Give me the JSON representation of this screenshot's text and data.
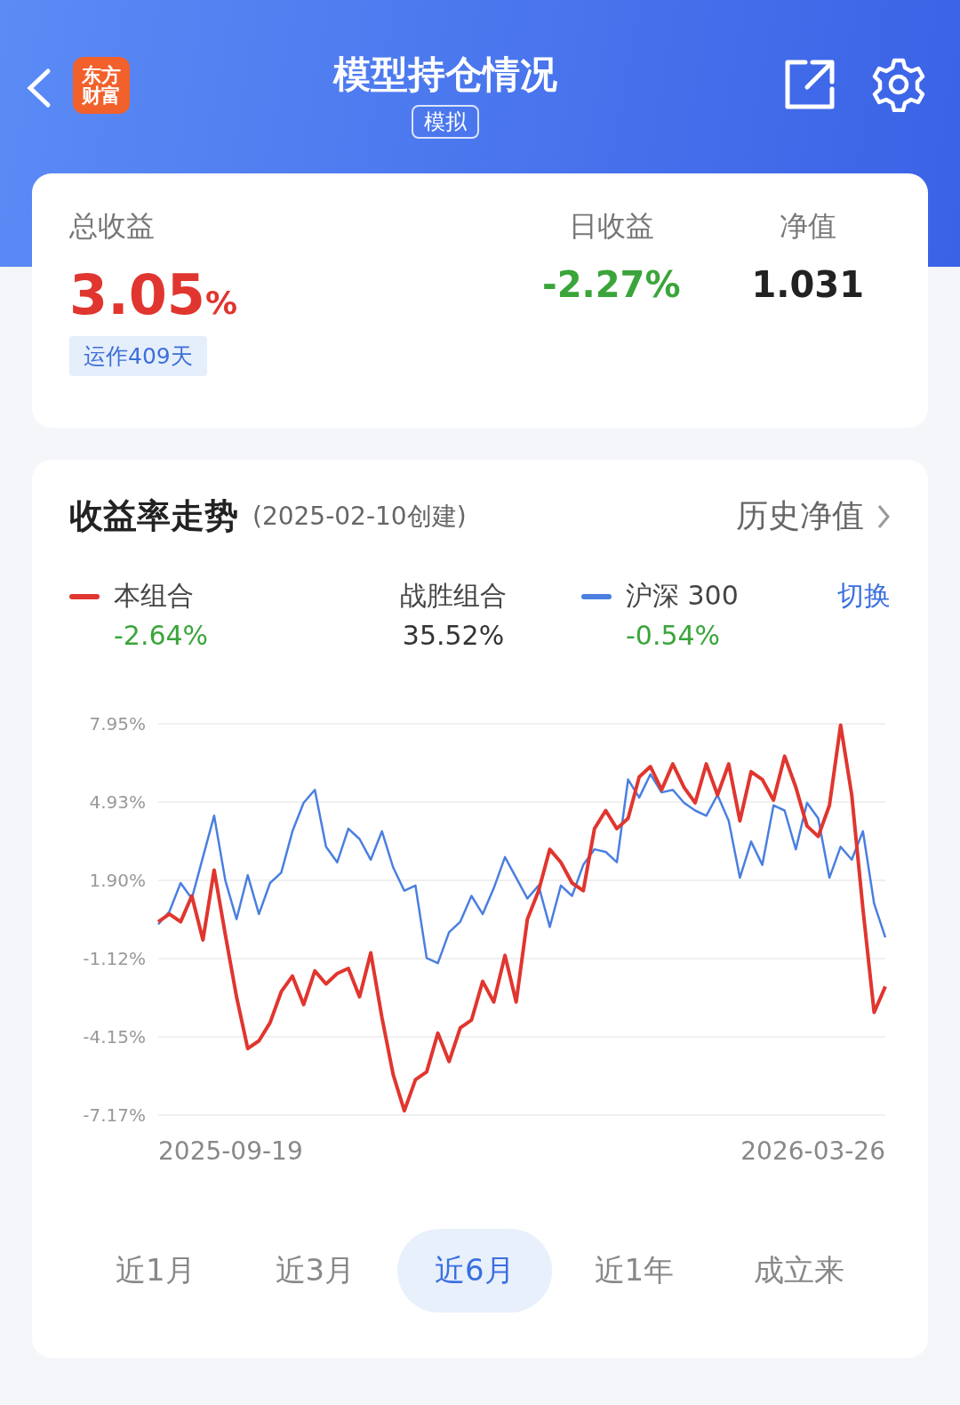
{
  "header": {
    "logo_lines": [
      "东方",
      "财富"
    ],
    "title": "模型持仓情况",
    "tag": "模拟"
  },
  "summary": {
    "total": {
      "label": "总收益",
      "value": "3.05",
      "unit": "%"
    },
    "days_badge": "运作409天",
    "daily": {
      "label": "日收益",
      "value": "-2.27%"
    },
    "nav": {
      "label": "净值",
      "value": "1.031"
    }
  },
  "trend": {
    "title": "收益率走势",
    "created": "(2025-02-10创建)",
    "history_link": "历史净值",
    "legend": [
      {
        "kind": "series",
        "value": "-2.64%"
      },
      {
        "kind": "plain",
        "label": "战胜组合",
        "value": "35.52%"
      },
      {
        "kind": "series",
        "value": "-0.54%"
      }
    ],
    "switch_link": "切换",
    "date_labels": [
      "2025-09-19",
      "2026-03-26"
    ],
    "chart_data": {
      "type": "line",
      "grid": true,
      "ylim": [
        -7.17,
        7.95
      ],
      "yticks": [
        {
          "value": 7.95,
          "label": "7.95%"
        },
        {
          "value": 4.93,
          "label": "4.93%"
        },
        {
          "value": 1.9,
          "label": "1.90%"
        },
        {
          "value": -1.12,
          "label": "-1.12%"
        },
        {
          "value": -4.15,
          "label": "-4.15%"
        },
        {
          "value": -7.17,
          "label": "-7.17%"
        }
      ],
      "series": [
        {
          "name": "本组合",
          "color": "#e0362f",
          "values": [
            0.3,
            0.6,
            0.3,
            1.3,
            -0.4,
            2.3,
            -0.2,
            -2.6,
            -4.6,
            -4.3,
            -3.6,
            -2.4,
            -1.8,
            -2.9,
            -1.6,
            -2.1,
            -1.7,
            -1.5,
            -2.6,
            -0.9,
            -3.4,
            -5.6,
            -7.0,
            -5.8,
            -5.5,
            -4.0,
            -5.1,
            -3.8,
            -3.5,
            -2.0,
            -2.8,
            -1.0,
            -2.8,
            0.4,
            1.5,
            3.1,
            2.6,
            1.8,
            1.5,
            3.9,
            4.6,
            3.9,
            4.3,
            5.9,
            6.3,
            5.4,
            6.4,
            5.5,
            4.9,
            6.4,
            5.2,
            6.4,
            4.2,
            6.1,
            5.8,
            5.0,
            6.7,
            5.5,
            4.0,
            3.6,
            4.8,
            7.9,
            5.2,
            0.8,
            -3.2,
            -2.2
          ]
        },
        {
          "name": "沪深 300",
          "color": "#4a7fe0",
          "values": [
            0.2,
            0.7,
            1.8,
            1.2,
            2.8,
            4.4,
            1.9,
            0.4,
            2.1,
            0.6,
            1.8,
            2.2,
            3.8,
            4.9,
            5.4,
            3.2,
            2.6,
            3.9,
            3.5,
            2.7,
            3.8,
            2.4,
            1.5,
            1.7,
            -1.1,
            -1.3,
            -0.1,
            0.3,
            1.3,
            0.6,
            1.6,
            2.8,
            2.0,
            1.2,
            1.7,
            0.1,
            1.7,
            1.3,
            2.5,
            3.1,
            3.0,
            2.6,
            5.8,
            5.1,
            6.0,
            5.3,
            5.4,
            4.9,
            4.6,
            4.4,
            5.2,
            4.2,
            2.0,
            3.4,
            2.5,
            4.8,
            4.6,
            3.1,
            4.9,
            4.3,
            2.0,
            3.2,
            2.7,
            3.8,
            1.0,
            -0.3
          ]
        }
      ]
    },
    "ranges": [
      {
        "label": "近1月",
        "selected": false
      },
      {
        "label": "近3月",
        "selected": false
      },
      {
        "label": "近6月",
        "selected": true
      },
      {
        "label": "近1年",
        "selected": false
      },
      {
        "label": "成立来",
        "selected": false
      }
    ]
  }
}
